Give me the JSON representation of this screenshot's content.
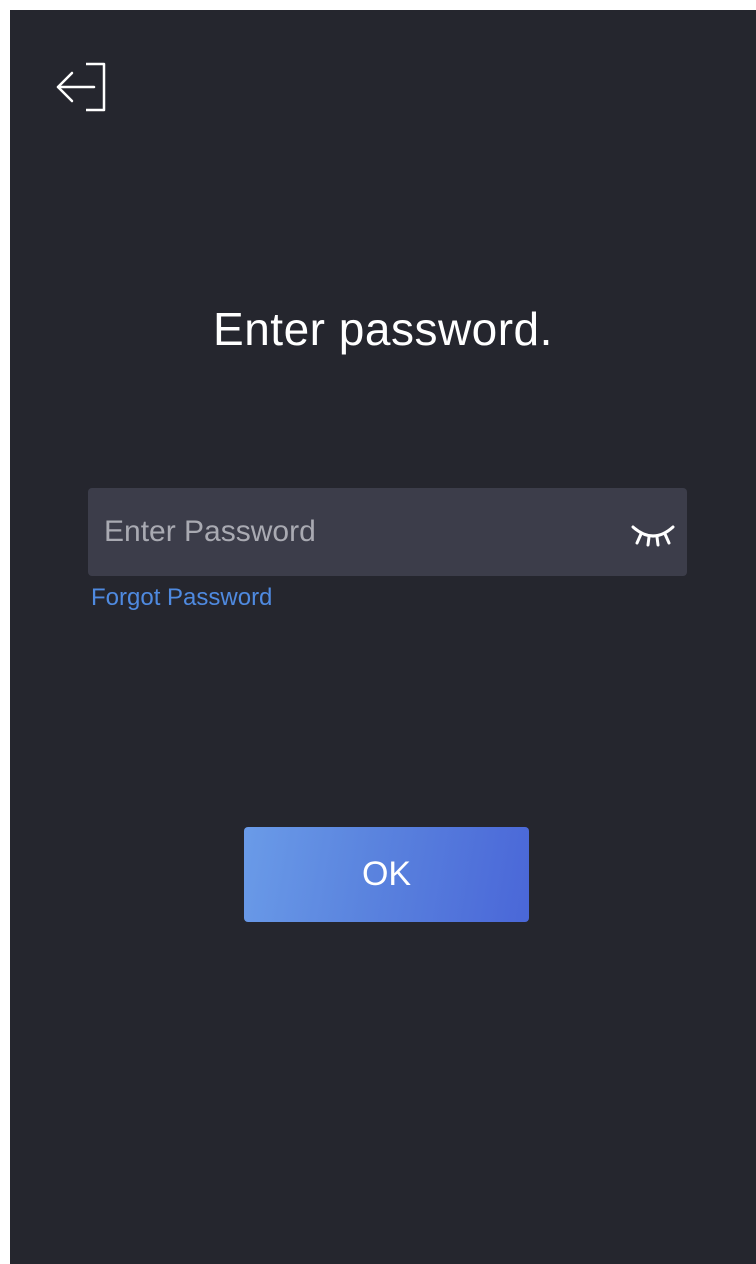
{
  "header": {
    "exit_icon": "exit-arrow-icon"
  },
  "title": "Enter password.",
  "password": {
    "placeholder": "Enter Password",
    "value": "",
    "toggle_icon": "eye-closed-icon"
  },
  "forgot_password_label": "Forgot Password",
  "ok_label": "OK",
  "colors": {
    "background": "#25262e",
    "input_background": "#3c3d4a",
    "link": "#4f8ae0",
    "button_gradient_start": "#6a9be8",
    "button_gradient_end": "#4a67d8"
  }
}
